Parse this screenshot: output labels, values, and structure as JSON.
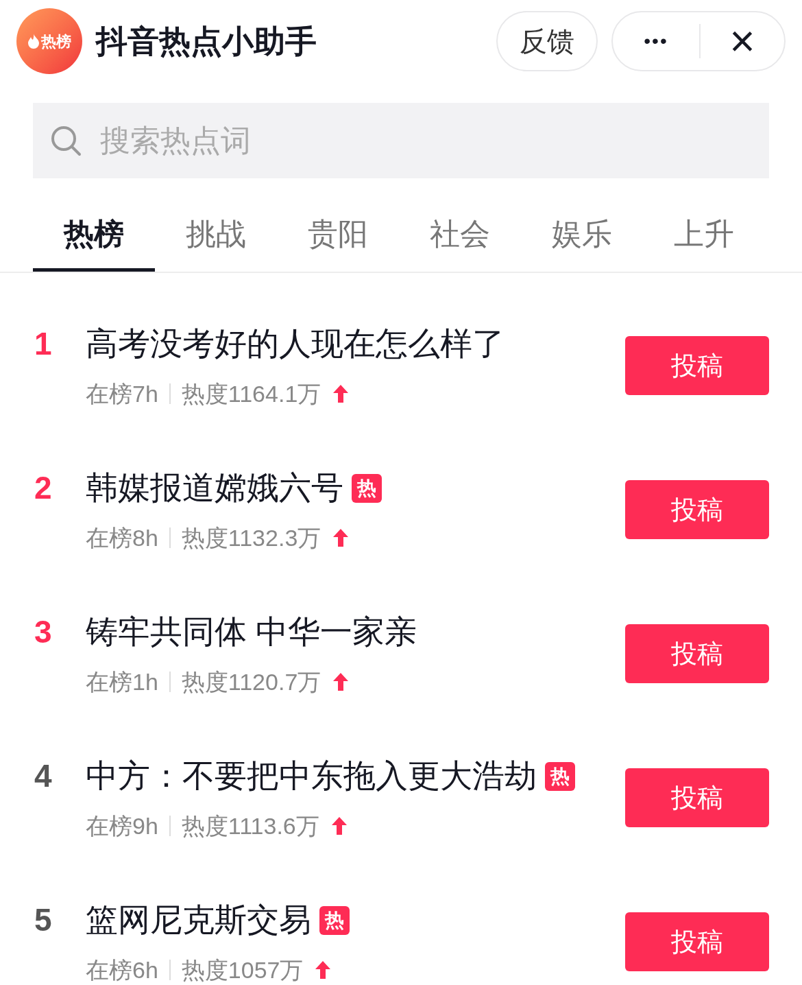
{
  "header": {
    "logo_text": "热榜",
    "title": "抖音热点小助手",
    "feedback": "反馈",
    "more": "•••",
    "close": "×"
  },
  "search": {
    "placeholder": "搜索热点词"
  },
  "tabs": [
    {
      "label": "热榜",
      "selected": true
    },
    {
      "label": "挑战",
      "selected": false
    },
    {
      "label": "贵阳",
      "selected": false
    },
    {
      "label": "社会",
      "selected": false
    },
    {
      "label": "娱乐",
      "selected": false
    },
    {
      "label": "上升",
      "selected": false
    }
  ],
  "items": [
    {
      "rank": "1",
      "highlighted": true,
      "title": "高考没考好的人现在怎么样了",
      "duration": "在榜7h",
      "heat": "热度1164.1万",
      "action": "投稿"
    },
    {
      "rank": "2",
      "highlighted": true,
      "title": "韩媒报道嫦娥六号",
      "badge": "热",
      "duration": "在榜8h",
      "heat": "热度1132.3万",
      "action": "投稿"
    },
    {
      "rank": "3",
      "highlighted": true,
      "title": "铸牢共同体 中华一家亲",
      "duration": "在榜1h",
      "heat": "热度1120.7万",
      "action": "投稿"
    },
    {
      "rank": "4",
      "highlighted": false,
      "title": "中方：不要把中东拖入更大浩劫",
      "badge": "热",
      "duration": "在榜9h",
      "heat": "热度1113.6万",
      "action": "投稿"
    },
    {
      "rank": "5",
      "highlighted": false,
      "title": "篮网尼克斯交易",
      "badge": "热",
      "duration": "在榜6h",
      "heat": "热度1057万",
      "action": "投稿"
    }
  ]
}
